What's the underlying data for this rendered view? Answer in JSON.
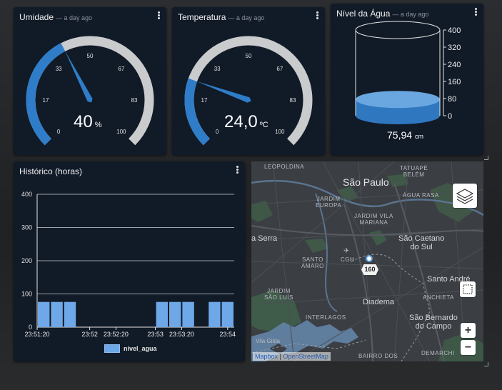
{
  "umidade": {
    "title": "Umidade",
    "ago": "— a day ago",
    "value": "40",
    "unit": "%",
    "needle_value": 40,
    "ticks": [
      "0",
      "17",
      "33",
      "50",
      "67",
      "83",
      "100"
    ],
    "min": 0,
    "max": 100
  },
  "temperatura": {
    "title": "Temperatura",
    "ago": "— a day ago",
    "value": "24,0",
    "unit": "ºC",
    "needle_value": 24,
    "ticks": [
      "0",
      "17",
      "33",
      "50",
      "67",
      "83",
      "100"
    ],
    "min": 0,
    "max": 100
  },
  "nivel": {
    "title": "Nível da Água",
    "ago": "— a day ago",
    "value": "75,94",
    "unit": "cm",
    "fill_value": 75.94,
    "scale": [
      "400",
      "320",
      "240",
      "160",
      "80",
      "0"
    ],
    "max": 400
  },
  "historico": {
    "title": "Histórico (horas)",
    "legend": "nivel_agua"
  },
  "chart_data": {
    "type": "bar",
    "title": "Histórico (horas)",
    "ylim": [
      0,
      400
    ],
    "yticks": [
      "0",
      "100",
      "200",
      "300",
      "400"
    ],
    "xticks": [
      "23:51:20",
      "23:52",
      "23:52:20",
      "23:53",
      "23:53:20",
      "23:54"
    ],
    "series": [
      {
        "name": "nivel_agua",
        "values": [
          75.9,
          75.9,
          75.9,
          75.9,
          75.9,
          75.9,
          75.9,
          75.9
        ],
        "slots": [
          0,
          1,
          2,
          9,
          10,
          11,
          13,
          14
        ]
      }
    ],
    "slot_count": 15,
    "grid": true,
    "legend": "bottom"
  },
  "map": {
    "labels": {
      "leopoldina": "LEOPOLDINA",
      "tatuape": "TATUAPÉ\nBELÉM",
      "sao_paulo": "São Paulo",
      "jardim_europa": "JARDIM\nEUROPA",
      "agua_rasa": "ÁGUA RASA",
      "jardim_vila_mariana": "JARDIM VILA\nMARIANA",
      "serra": "a Serra",
      "sao_caetano": "São Caetano\ndo Sul",
      "santo_amaro": "SANTO\nAMARO",
      "cgh": "CGH",
      "route": "160",
      "santo_andre": "Santo André",
      "jardim_sao_luis": "JARDIM\nSÃO LUÍS",
      "anchieta": "ANCHIETA",
      "diadema": "Diadema",
      "interlagos": "INTERLAGOS",
      "sao_bernardo": "São Bernardo\ndo Campo",
      "vila_gilda": "Vila Gilda",
      "demarchi": "DEMARCHI",
      "bairro_dos": "BAIRRO DOS"
    },
    "attribution": {
      "mapbox": "Mapbox",
      "sep": "|",
      "osm": "OpenStreetMap"
    },
    "zoom_in": "+",
    "zoom_out": "−"
  },
  "colors": {
    "accent": "#2f7dc8",
    "track": "#c9cbcd",
    "bar": "#6ea8e8",
    "card": "#111a27"
  }
}
